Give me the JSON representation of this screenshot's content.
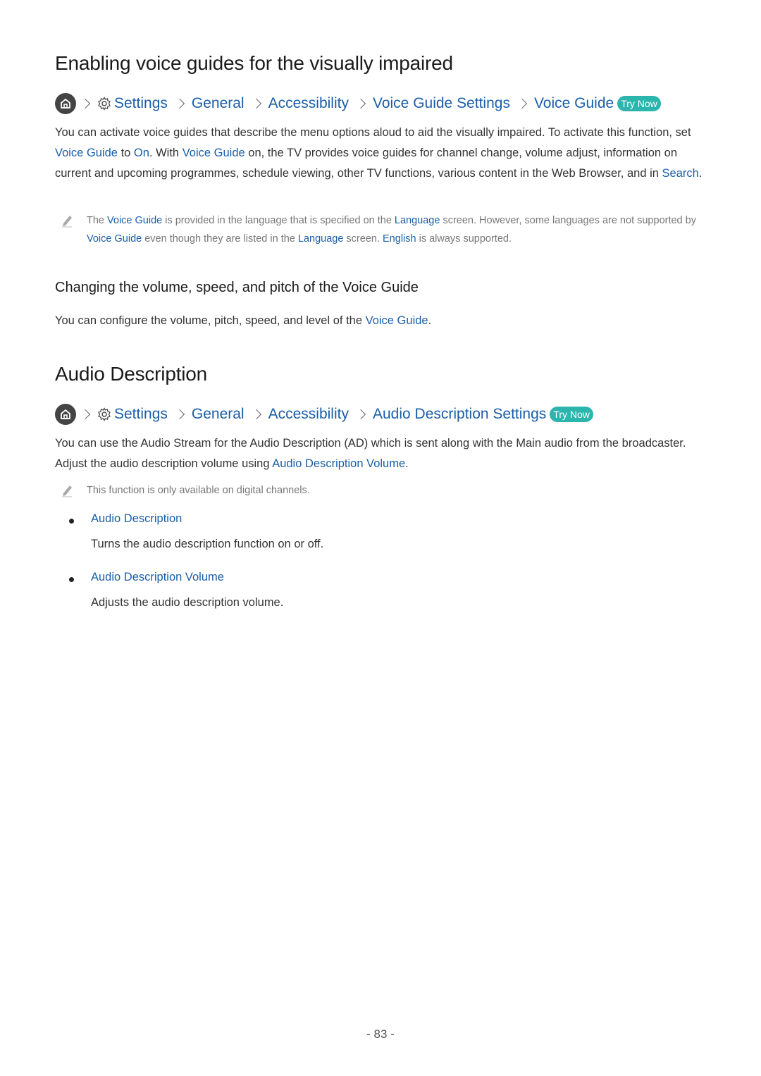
{
  "section1": {
    "title": "Enabling voice guides for the visually impaired",
    "breadcrumb": [
      "Settings",
      "General",
      "Accessibility",
      "Voice Guide Settings",
      "Voice Guide"
    ],
    "try_now": "Try Now",
    "body": {
      "t1": "You can activate voice guides that describe the menu options aloud to aid the visually impaired. To activate this function, set ",
      "l1": "Voice Guide",
      "t2": " to ",
      "l2": "On",
      "t3": ". With ",
      "l3": "Voice Guide",
      "t4": " on, the TV provides voice guides for channel change, volume adjust, information on current and upcoming programmes, schedule viewing, other TV functions, various content in the Web Browser, and in ",
      "l4": "Search",
      "t5": "."
    },
    "note": {
      "t1": "The ",
      "l1": "Voice Guide",
      "t2": " is provided in the language that is specified on the ",
      "l2": "Language",
      "t3": " screen. However, some languages are not supported by ",
      "l3": "Voice Guide",
      "t4": " even though they are listed in the ",
      "l4": "Language",
      "t5": " screen. ",
      "l5": "English",
      "t6": " is always supported."
    },
    "subheading": "Changing the volume, speed, and pitch of the Voice Guide",
    "sub_body": {
      "t1": "You can configure the volume, pitch, speed, and level of the ",
      "l1": "Voice Guide",
      "t2": "."
    }
  },
  "section2": {
    "title": "Audio Description",
    "breadcrumb": [
      "Settings",
      "General",
      "Accessibility",
      "Audio Description Settings"
    ],
    "try_now": "Try Now",
    "body": {
      "t1": "You can use the Audio Stream for the Audio Description (AD) which is sent along with the Main audio from the broadcaster. Adjust the audio description volume using ",
      "l1": "Audio Description Volume",
      "t2": "."
    },
    "note": "This function is only available on digital channels.",
    "items": [
      {
        "title": "Audio Description",
        "desc": "Turns the audio description function on or off."
      },
      {
        "title": "Audio Description Volume",
        "desc": "Adjusts the audio description volume."
      }
    ]
  },
  "page_number": "- 83 -",
  "colors": {
    "link": "#1a5ea8",
    "try_now_bg": "#2bb5ad",
    "note_text": "#777777"
  }
}
